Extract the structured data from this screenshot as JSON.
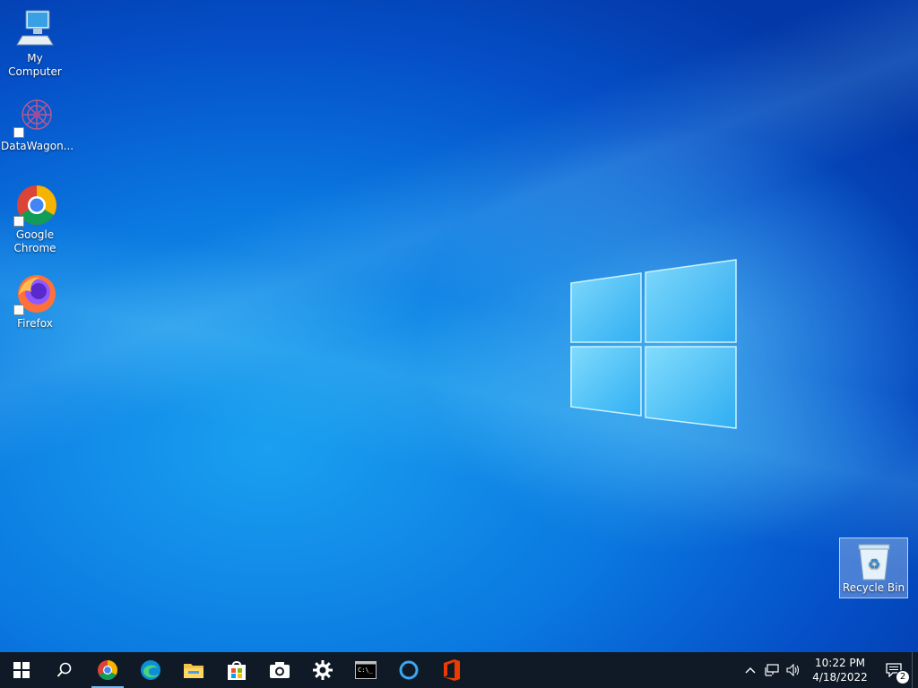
{
  "desktop": {
    "icons": [
      {
        "label": "My Computer",
        "icon": "computer-icon",
        "shortcut": false
      },
      {
        "label": "DataWagon...",
        "icon": "datawagon-icon",
        "shortcut": true
      },
      {
        "label": "Google Chrome",
        "icon": "chrome-icon",
        "shortcut": true
      },
      {
        "label": "Firefox",
        "icon": "firefox-icon",
        "shortcut": true
      }
    ],
    "recycle_bin": {
      "label": "Recycle Bin",
      "icon": "recycle-bin-icon"
    }
  },
  "taskbar": {
    "apps": [
      {
        "name": "start",
        "icon": "windows-start-icon"
      },
      {
        "name": "search",
        "icon": "search-icon"
      },
      {
        "name": "chrome",
        "icon": "chrome-icon",
        "active": true
      },
      {
        "name": "edge",
        "icon": "edge-icon"
      },
      {
        "name": "file-explorer",
        "icon": "folder-icon"
      },
      {
        "name": "store",
        "icon": "store-icon"
      },
      {
        "name": "camera",
        "icon": "camera-icon"
      },
      {
        "name": "settings",
        "icon": "gear-icon"
      },
      {
        "name": "terminal",
        "icon": "terminal-icon"
      },
      {
        "name": "cortana",
        "icon": "cortana-icon"
      },
      {
        "name": "office",
        "icon": "office-icon"
      }
    ],
    "tray": {
      "time": "10:22 PM",
      "date": "4/18/2022",
      "notification_count": "2"
    }
  },
  "colors": {
    "taskbar_bg": "#0f1a26",
    "active_indicator": "#76b9ed",
    "desktop_blue": "#0a78e0"
  }
}
